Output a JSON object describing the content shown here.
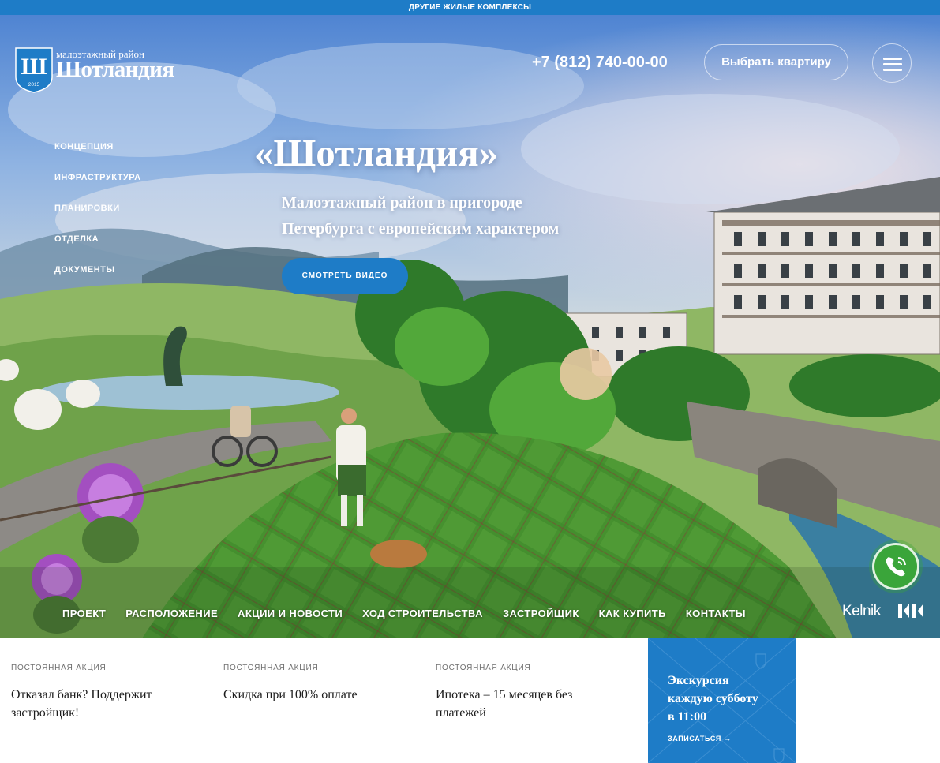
{
  "topbar": {
    "label": "ДРУГИЕ ЖИЛЫЕ КОМПЛЕКСЫ"
  },
  "logo": {
    "subtitle": "малоэтажный район",
    "name": "Шотландия",
    "letter": "Ш",
    "year": "2015"
  },
  "header": {
    "phone": "+7 (812) 740-00-00",
    "choose_label": "Выбрать квартиру",
    "menu_icon": "hamburger-icon"
  },
  "side_nav": {
    "items": [
      {
        "label": "КОНЦЕПЦИЯ"
      },
      {
        "label": "ИНФРАСТРУКТУРА"
      },
      {
        "label": "ПЛАНИРОВКИ"
      },
      {
        "label": "ОТДЕЛКА"
      },
      {
        "label": "ДОКУМЕНТЫ"
      }
    ]
  },
  "hero": {
    "title": "«Шотландия»",
    "subtitle_line1": "Малоэтажный район в пригороде",
    "subtitle_line2": "Петербурга с европейским характером",
    "video_label": "СМОТРЕТЬ ВИДЕО"
  },
  "main_nav": {
    "items": [
      {
        "label": "ПРОЕКТ"
      },
      {
        "label": "РАСПОЛОЖЕНИЕ"
      },
      {
        "label": "АКЦИИ И НОВОСТИ"
      },
      {
        "label": "ХОД СТРОИТЕЛЬСТВА"
      },
      {
        "label": "ЗАСТРОЙЩИК"
      },
      {
        "label": "КАК КУПИТЬ"
      },
      {
        "label": "КОНТАКТЫ"
      }
    ]
  },
  "call": {
    "icon": "phone-icon"
  },
  "developer": {
    "name": "Kelnik"
  },
  "promos": [
    {
      "kicker": "ПОСТОЯННАЯ АКЦИЯ",
      "title": "Отказал банк? Поддержит застройщик!"
    },
    {
      "kicker": "ПОСТОЯННАЯ АКЦИЯ",
      "title": "Скидка при 100% оплате"
    },
    {
      "kicker": "ПОСТОЯННАЯ АКЦИЯ",
      "title": "Ипотека – 15 месяцев без платежей"
    }
  ],
  "excursion": {
    "title": "Экскурсия",
    "line2": "каждую субботу",
    "line3": "в 11:00",
    "link": "ЗАПИСАТЬСЯ →"
  },
  "colors": {
    "accent": "#1e7cc7",
    "call": "#3aa53a"
  }
}
